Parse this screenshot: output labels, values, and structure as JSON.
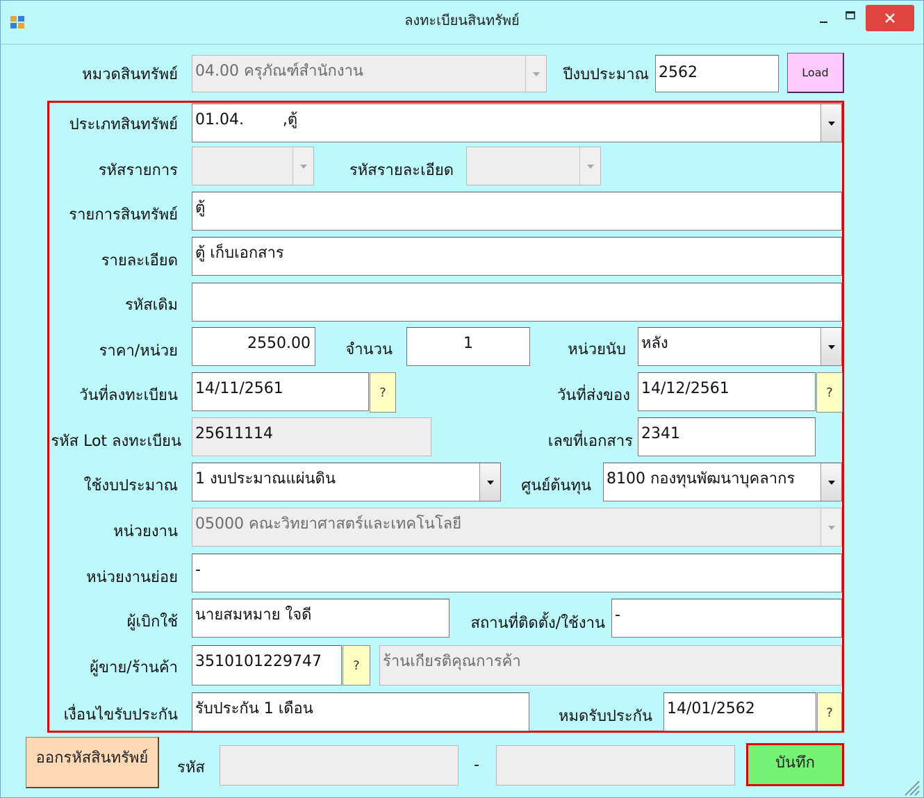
{
  "window": {
    "title": "ลงทะเบียนสินทรัพย์"
  },
  "icons": {
    "app": "app-icon",
    "minimize": "minimize-icon",
    "maximize": "maximize-icon",
    "close": "close-icon"
  },
  "colors": {
    "background": "#bdf9fc",
    "close_button": "#e0443e",
    "load_button": "#fbc9fb",
    "save_button": "#74f274",
    "generate_button": "#fdd9b6",
    "highlight_border": "#e00000"
  },
  "header": {
    "category_label": "หมวดสินทรัพย์",
    "category_value": "04.00 ครุภัณฑ์สำนักงาน",
    "budget_year_label": "ปีงบประมาณ",
    "budget_year_value": "2562",
    "load_label": "Load"
  },
  "form": {
    "asset_type_label": "ประเภทสินทรัพย์",
    "asset_type_value": "01.04.        ,ตู้",
    "item_code_label": "รหัสรายการ",
    "item_code_value": "",
    "detail_code_label": "รหัสรายละเอียด",
    "detail_code_value": "",
    "item_name_label": "รายการสินทรัพย์",
    "item_name_value": "ตู้",
    "detail_label": "รายละเอียด",
    "detail_value": "ตู้ เก็บเอกสาร",
    "old_code_label": "รหัสเดิม",
    "old_code_value": "",
    "unit_price_label": "ราคา/หน่วย",
    "unit_price_value": "2550.00",
    "quantity_label": "จำนวน",
    "quantity_value": "1",
    "unit_label": "หน่วยนับ",
    "unit_value": "หลัง",
    "register_date_label": "วันที่ลงทะเบียน",
    "register_date_value": "14/11/2561",
    "delivery_date_label": "วันที่ส่งของ",
    "delivery_date_value": "14/12/2561",
    "lot_code_label": "รหัส Lot ลงทะเบียน",
    "lot_code_value": "25611114",
    "doc_no_label": "เลขที่เอกสาร",
    "doc_no_value": "2341",
    "budget_label": "ใช้งบประมาณ",
    "budget_value": "1 งบประมาณแผ่นดิน",
    "cost_center_label": "ศูนย์ต้นทุน",
    "cost_center_value": "8100 กองทุนพัฒนาบุคลากร",
    "department_label": "หน่วยงาน",
    "department_value": "05000 คณะวิทยาศาสตร์และเทคโนโลยี",
    "sub_department_label": "หน่วยงานย่อย",
    "sub_department_value": "-",
    "requester_label": "ผู้เบิกใช้",
    "requester_value": "นายสมหมาย ใจดี",
    "location_label": "สถานที่ติดตั้ง/ใช้งาน",
    "location_value": "-",
    "vendor_label": "ผู้ขาย/ร้านค้า",
    "vendor_id_value": "3510101229747",
    "vendor_name_value": "ร้านเกียรติคุณการค้า",
    "warranty_label": "เงื่อนไขรับประกัน",
    "warranty_value": "รับประกัน 1 เดือน",
    "warranty_end_label": "หมดรับประกัน",
    "warranty_end_value": "14/01/2562",
    "picker_label": "?"
  },
  "footer": {
    "generate_label": "ออกรหัสสินทรัพย์",
    "code_label": "รหัส",
    "code_part1": "",
    "separator": "-",
    "code_part2": "",
    "save_label": "บันทึก"
  }
}
